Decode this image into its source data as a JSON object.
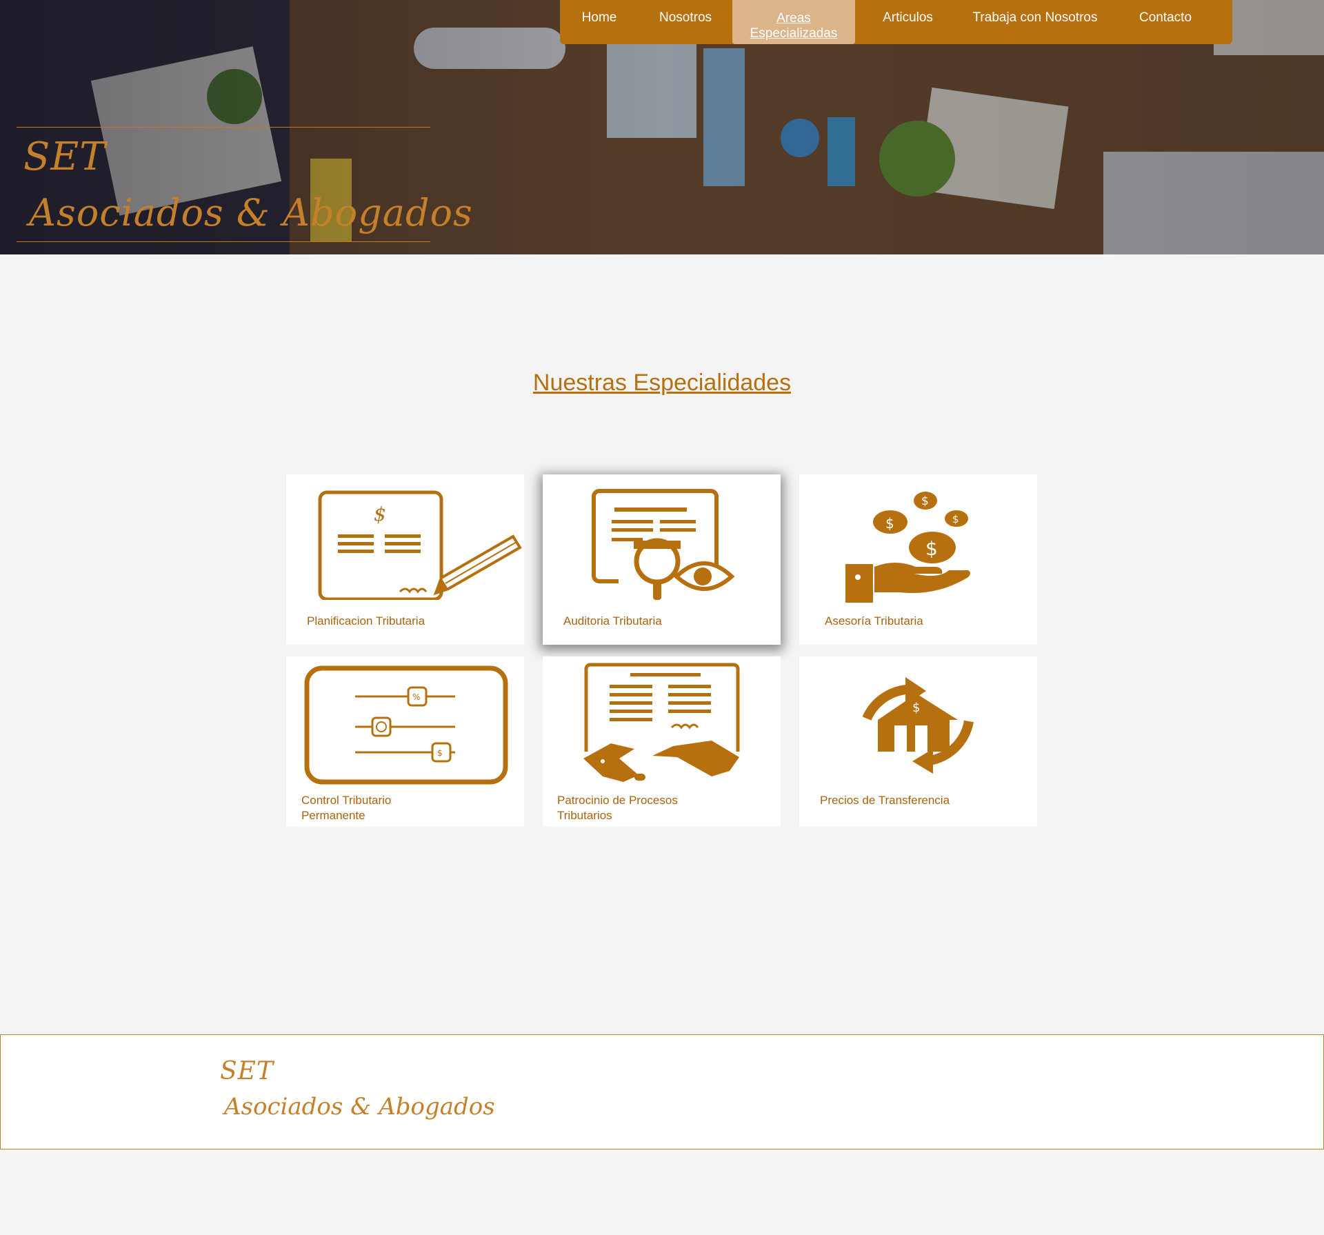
{
  "nav": {
    "items": [
      {
        "label": "Home"
      },
      {
        "label": "Nosotros"
      },
      {
        "label_line1": "Areas",
        "label_line2": "Especializadas",
        "active": true
      },
      {
        "label": "Articulos"
      },
      {
        "label": "Trabaja con Nosotros"
      },
      {
        "label": "Contacto"
      }
    ]
  },
  "brand": {
    "line1": "SET",
    "line2": "Asociados & Abogados"
  },
  "section": {
    "title": "Nuestras Especialidades"
  },
  "cards": [
    {
      "label": "Planificacion Tributaria",
      "icon": "signed-document-icon"
    },
    {
      "label": "Auditoria Tributaria",
      "icon": "audit-magnifier-eye-icon"
    },
    {
      "label": "Asesoría Tributaria",
      "icon": "hand-coins-icon"
    },
    {
      "label_line1": "Control Tributario",
      "label_line2": "Permanente",
      "icon": "sliders-panel-icon"
    },
    {
      "label_line1": "Patrocinio de Procesos",
      "label_line2": "Tributarios",
      "icon": "handshake-document-icon"
    },
    {
      "label": "Precios de Transferencia",
      "icon": "house-transfer-icon"
    }
  ],
  "footer": {
    "line1": "SET",
    "line2": "Asociados & Abogados"
  },
  "colors": {
    "accent": "#b7700f",
    "active_nav": "#dbb489",
    "brand_text": "#c4802a",
    "page_bg": "#f4f4f4"
  }
}
